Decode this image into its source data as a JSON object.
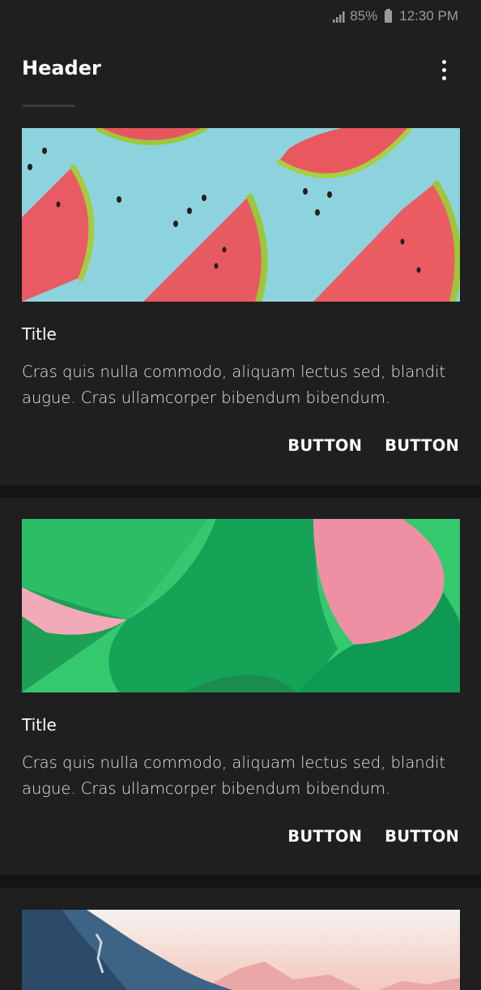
{
  "status_bar": {
    "battery": "85%",
    "time": "12:30 PM",
    "icons": [
      "signal-icon",
      "battery-icon"
    ]
  },
  "header": {
    "title": "Header",
    "menu_icon": "more-vert-icon"
  },
  "cards": [
    {
      "image": "watermelon-slices-photo",
      "title": "Title",
      "text": "Cras quis nulla commodo, aliquam lectus sed, blandit augue. Cras ullamcorper bibendum bibendum.",
      "buttons": [
        "BUTTON",
        "BUTTON"
      ]
    },
    {
      "image": "green-pink-paper-curves-photo",
      "title": "Title",
      "text": "Cras quis nulla commodo, aliquam lectus sed, blandit augue. Cras ullamcorper bibendum bibendum.",
      "buttons": [
        "BUTTON",
        "BUTTON"
      ]
    },
    {
      "image": "mountain-landscape-photo"
    }
  ],
  "colors": {
    "background": "#151515",
    "surface": "#1f1f1f",
    "text": "#fafafa",
    "status_text": "#9a9a9a"
  }
}
